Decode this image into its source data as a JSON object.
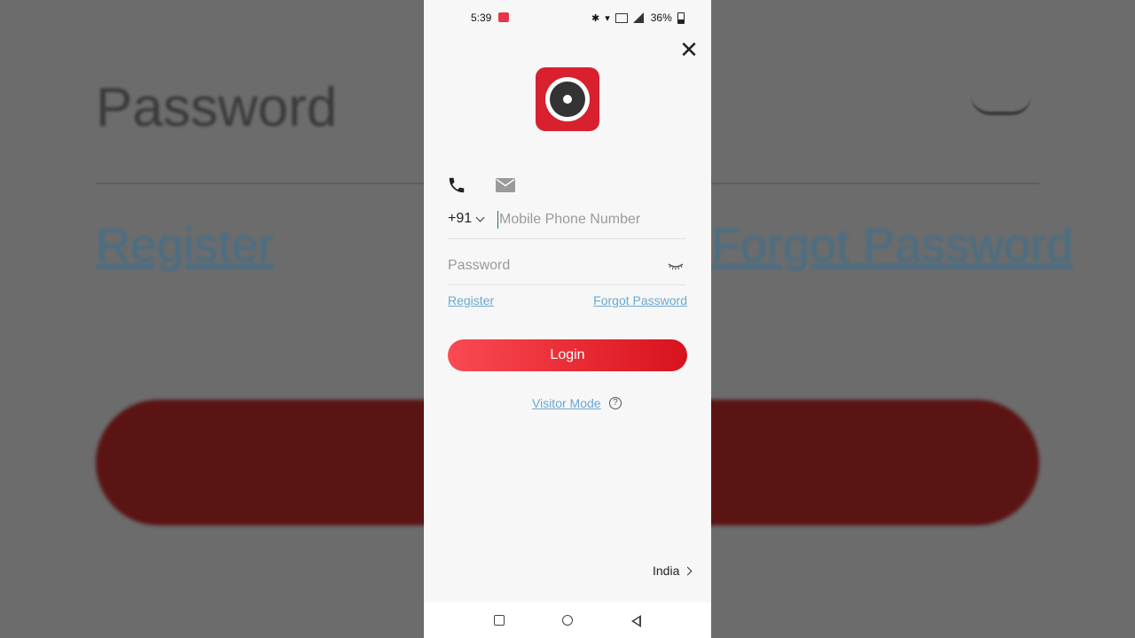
{
  "background": {
    "password_text": "Password",
    "register_text": "Register",
    "forgot_text": "Forgot Password"
  },
  "statusbar": {
    "time": "5:39",
    "vowifi": "Vo WiFi",
    "battery": "36%"
  },
  "login": {
    "country_code": "+91",
    "phone_placeholder": "Mobile Phone Number",
    "password_placeholder": "Password",
    "register_label": "Register",
    "forgot_label": "Forgot Password",
    "login_label": "Login",
    "visitor_label": "Visitor Mode",
    "help_glyph": "?",
    "region": "India",
    "close_glyph": "✕"
  },
  "colors": {
    "brand_red": "#d8202e",
    "link_blue": "#6aa8d3"
  },
  "icons": [
    "close-icon",
    "app-logo",
    "phone-icon",
    "mail-icon",
    "eye-closed-icon",
    "help-icon",
    "chevron-right-icon",
    "nav-recents-icon",
    "nav-home-icon",
    "nav-back-icon"
  ]
}
